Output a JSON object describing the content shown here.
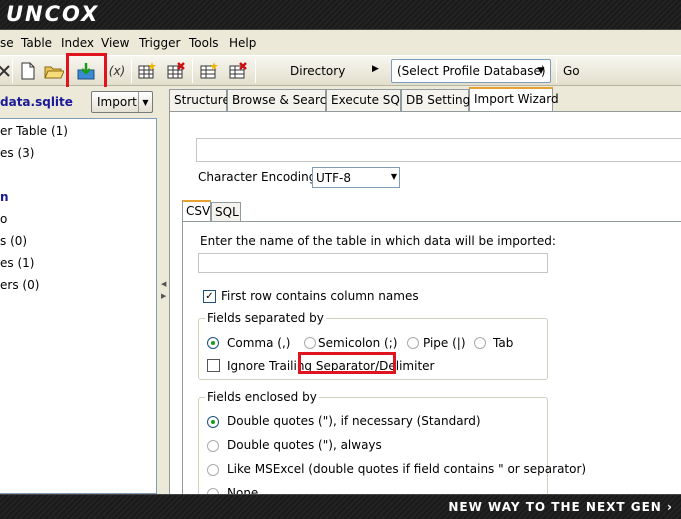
{
  "brand": {
    "logo_text": "UNCOX",
    "slogan": "NEW WAY TO THE NEXT GEN"
  },
  "menu": [
    "se",
    "Table",
    "Index",
    "View",
    "Trigger",
    "Tools",
    "Help"
  ],
  "toolbar": {
    "icons": [
      "close-icon",
      "new-file-icon",
      "open-folder-icon",
      "import-icon",
      "function-icon",
      "create-table-icon",
      "delete-table-icon",
      "create-index-icon",
      "delete-index-icon"
    ],
    "function_label": "(x)",
    "directory_label": "Directory",
    "profile_select": "(Select Profile Database)",
    "go_label": "Go",
    "highlight_color": "#e0141e"
  },
  "left_panel": {
    "db_name": "data.sqlite",
    "import_label": "Import",
    "tree": [
      {
        "text": "er Table (1)",
        "bold": false
      },
      {
        "text": "es (3)",
        "bold": false
      },
      {
        "text": "",
        "bold": false
      },
      {
        "text": "n",
        "bold": true
      },
      {
        "text": "o",
        "bold": false
      },
      {
        "text": "s (0)",
        "bold": false
      },
      {
        "text": "es (1)",
        "bold": false
      },
      {
        "text": "ers (0)",
        "bold": false
      }
    ]
  },
  "tabs": [
    "Structure",
    "Browse & Search",
    "Execute SQL",
    "DB Settings",
    "Import Wizard"
  ],
  "active_tab": "Import Wizard",
  "import": {
    "encoding_label": "Character Encoding",
    "encoding_value": "UTF-8",
    "subtabs": [
      "CSV",
      "SQL"
    ],
    "table_prompt": "Enter the name of the table in which data will be imported:",
    "first_row_label": "First row contains column names",
    "first_row_checked": true,
    "separated_title": "Fields separated by",
    "separators": [
      {
        "label": "Comma (,)",
        "selected": true
      },
      {
        "label": "Semicolon (;)",
        "selected": false
      },
      {
        "label": "Pipe (|)",
        "selected": false
      },
      {
        "label": "Tab",
        "selected": false
      }
    ],
    "ignore_trailing_label": "Ignore Trailing Separator/Delimiter",
    "enclosed_title": "Fields enclosed by",
    "enclosures": [
      {
        "label": "Double quotes (\"), if necessary (Standard)",
        "selected": true
      },
      {
        "label": "Double quotes (\"), always",
        "selected": false
      },
      {
        "label": "Like MSExcel (double quotes if field contains \" or separator)",
        "selected": false
      },
      {
        "label": "None",
        "selected": false
      }
    ]
  }
}
